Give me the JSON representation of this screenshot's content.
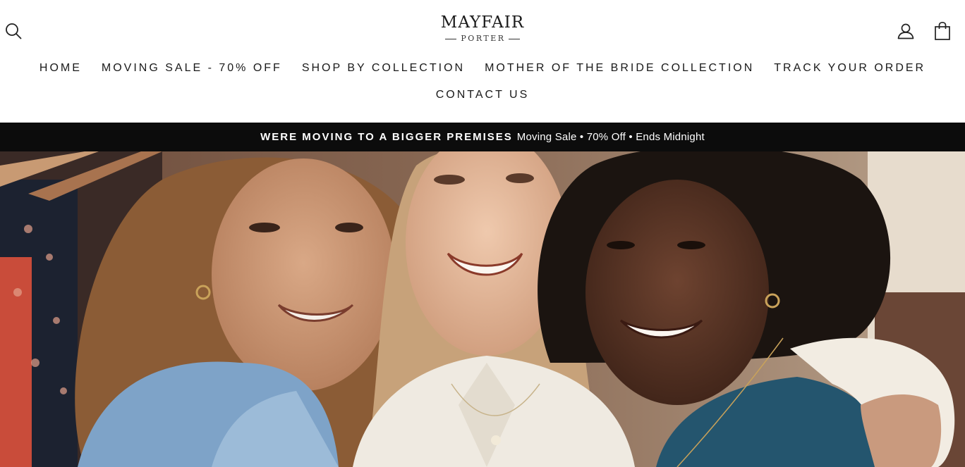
{
  "header": {
    "logo": {
      "main": "MAYFAIR",
      "sub": "PORTER"
    },
    "icons": {
      "search": "search-icon",
      "account": "user-icon",
      "cart": "shopping-bag-icon"
    }
  },
  "nav": {
    "items": [
      {
        "label": "HOME"
      },
      {
        "label": "MOVING SALE - 70% OFF"
      },
      {
        "label": "SHOP BY COLLECTION"
      },
      {
        "label": "MOTHER OF THE BRIDE COLLECTION"
      },
      {
        "label": "TRACK YOUR ORDER"
      },
      {
        "label": "CONTACT US"
      }
    ]
  },
  "announcement": {
    "bold": "WERE MOVING TO A BIGGER PREMISES",
    "text": "Moving Sale • 70% Off • Ends Midnight"
  },
  "colors": {
    "announcement_bg": "#0c0c0c",
    "text": "#1a1a1a",
    "background": "#ffffff"
  }
}
